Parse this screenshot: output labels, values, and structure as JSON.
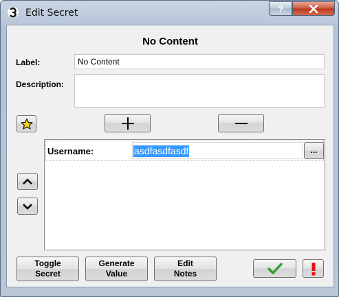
{
  "window": {
    "title": "Edit Secret",
    "help_label": "?",
    "close_icon": "close-x-icon",
    "app_icon": "app-logo-icon"
  },
  "dialog": {
    "heading": "No Content",
    "label_caption": "Label:",
    "label_value": "No Content",
    "description_caption": "Description:",
    "description_value": ""
  },
  "toolbar": {
    "star_icon": "star-icon",
    "add_icon": "plus-icon",
    "remove_icon": "minus-icon",
    "up_icon": "chevron-up-icon",
    "down_icon": "chevron-down-icon"
  },
  "fields": [
    {
      "name": "Username:",
      "value": "asdfasdfasdf",
      "more_label": "..."
    }
  ],
  "footer": {
    "toggle_secret": "Toggle\nSecret",
    "generate_value": "Generate\nValue",
    "edit_notes": "Edit\nNotes",
    "ok_icon": "checkmark-icon",
    "alert_icon": "exclamation-icon"
  },
  "colors": {
    "selection": "#3399ff",
    "ok_green": "#2e9e2e",
    "alert_red": "#e01010",
    "star_yellow": "#f7d81c"
  }
}
